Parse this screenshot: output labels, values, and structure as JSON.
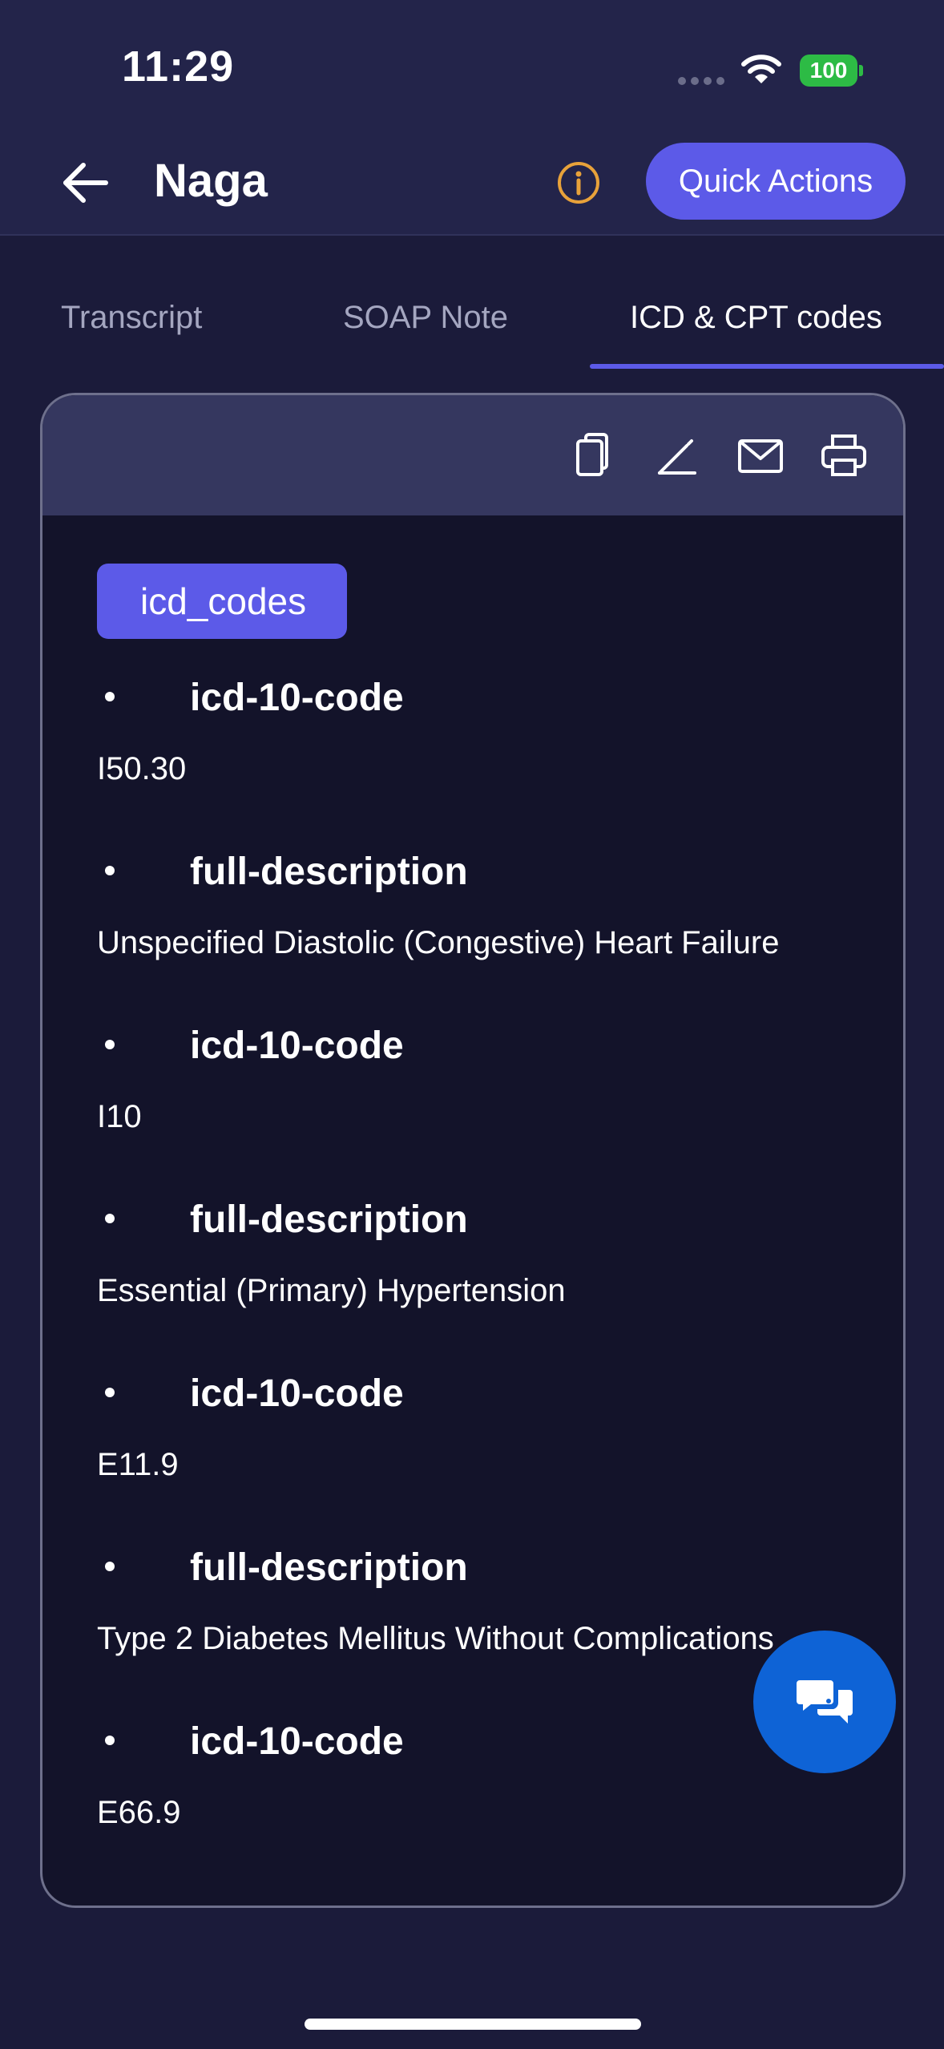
{
  "status_bar": {
    "time": "11:29",
    "battery": "100",
    "icons": [
      "signal-dots-icon",
      "wifi-icon",
      "battery-icon"
    ]
  },
  "header": {
    "title": "Naga",
    "quick_actions_label": "Quick Actions",
    "icons": [
      "back-arrow-icon",
      "info-icon"
    ]
  },
  "tabs": [
    {
      "label": "Transcript",
      "active": false
    },
    {
      "label": "SOAP Note",
      "active": false
    },
    {
      "label": "ICD & CPT codes",
      "active": true
    }
  ],
  "toolbar_icons": [
    "copy-icon",
    "edit-pencil-icon",
    "email-icon",
    "print-icon"
  ],
  "section": {
    "title": "icd_codes"
  },
  "entries": [
    {
      "key": "icd-10-code",
      "value": "I50.30"
    },
    {
      "key": "full-description",
      "value": "Unspecified Diastolic (Congestive) Heart Failure"
    },
    {
      "key": "icd-10-code",
      "value": "I10"
    },
    {
      "key": "full-description",
      "value": "Essential (Primary) Hypertension"
    },
    {
      "key": "icd-10-code",
      "value": "E11.9"
    },
    {
      "key": "full-description",
      "value": "Type 2 Diabetes Mellitus Without Complications"
    },
    {
      "key": "icd-10-code",
      "value": "E66.9"
    }
  ],
  "colors": {
    "accent": "#5c5ae8",
    "background": "#1b1b3a",
    "header": "#23244a",
    "card": "#13132a",
    "toolbar": "#35375f",
    "fab": "#0e63d6",
    "battery": "#2dbb45",
    "info": "#e8a23a"
  }
}
